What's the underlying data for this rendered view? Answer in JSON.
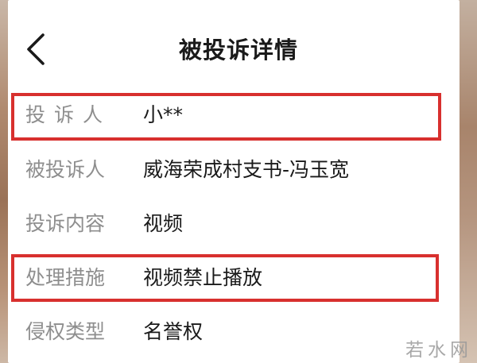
{
  "header": {
    "title": "被投诉详情",
    "back_icon": "chevron-left-icon"
  },
  "details": [
    {
      "label": "投诉人",
      "value": "小**",
      "highlighted": true
    },
    {
      "label": "被投诉人",
      "value": "威海荣成村支书-冯玉宽",
      "highlighted": false
    },
    {
      "label": "投诉内容",
      "value": "视频",
      "highlighted": false
    },
    {
      "label": "处理措施",
      "value": "视频禁止播放",
      "highlighted": true
    },
    {
      "label": "侵权类型",
      "value": "名誉权",
      "highlighted": false
    }
  ],
  "highlight_color": "#d8302e",
  "watermark": "若水网"
}
